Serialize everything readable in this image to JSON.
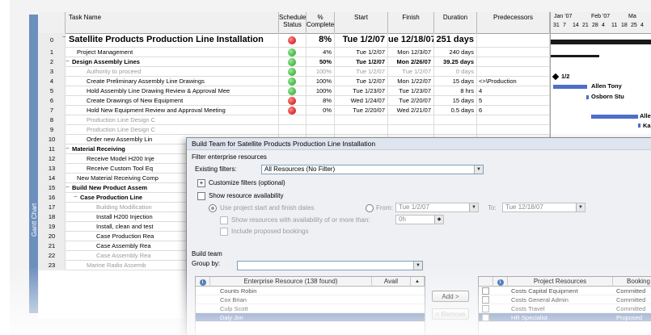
{
  "side_tab": "Gantt Chart",
  "columns": {
    "task_name": "Task Name",
    "schedule_status": "Schedule Status",
    "percent_complete": "% Complete",
    "start": "Start",
    "finish": "Finish",
    "duration": "Duration",
    "predecessors": "Predecessors"
  },
  "gantt_header": {
    "months": [
      "Jan '07",
      "Feb '07",
      "Ma"
    ],
    "days": [
      "31",
      "7",
      "14",
      "21",
      "28",
      "4",
      "11",
      "18",
      "25",
      "4"
    ]
  },
  "gantt_labels": [
    "1/2",
    "Allen Tony",
    "Osborn Stu",
    "Allen",
    "Kahn"
  ],
  "tasks": [
    {
      "id": "0",
      "name": "Satellite Products Production Line Installation",
      "status": "red",
      "pct": "8%",
      "start": "Tue 1/2/07",
      "finish": "ue 12/18/07",
      "duration": "251 days",
      "pred": "",
      "style": "big"
    },
    {
      "id": "1",
      "name": "Project Management",
      "status": "green",
      "pct": "4%",
      "start": "Tue 1/2/07",
      "finish": "Mon 12/3/07",
      "duration": "240 days",
      "pred": "",
      "style": "indent1"
    },
    {
      "id": "2",
      "name": "Design Assembly Lines",
      "status": "green",
      "pct": "50%",
      "start": "Tue 1/2/07",
      "finish": "Mon 2/26/07",
      "duration": "39.25 days",
      "pred": "",
      "style": "summary"
    },
    {
      "id": "3",
      "name": "Authority to proceed",
      "status": "green",
      "pct": "100%",
      "start": "Tue 1/2/07",
      "finish": "Tue 1/2/07",
      "duration": "0 days",
      "pred": "",
      "style": "done"
    },
    {
      "id": "4",
      "name": "Create Preliminary Assembly Line Drawings",
      "status": "green",
      "pct": "100%",
      "start": "Tue 1/2/07",
      "finish": "Mon 1/22/07",
      "duration": "15 days",
      "pred": "<>\\Production",
      "style": "indent2"
    },
    {
      "id": "5",
      "name": "Hold Assembly Line Drawing Review & Approval Mee",
      "status": "green",
      "pct": "100%",
      "start": "Tue 1/23/07",
      "finish": "Tue 1/23/07",
      "duration": "8 hrs",
      "pred": "4",
      "style": "indent2"
    },
    {
      "id": "6",
      "name": "Create Drawings of New Equipment",
      "status": "red",
      "pct": "8%",
      "start": "Wed 1/24/07",
      "finish": "Tue 2/20/07",
      "duration": "15 days",
      "pred": "5",
      "style": "indent2"
    },
    {
      "id": "7",
      "name": "Hold New Equipment Review and Approval Meeting",
      "status": "red",
      "pct": "0%",
      "start": "Tue 2/20/07",
      "finish": "Wed 2/21/07",
      "duration": "0.5 days",
      "pred": "6",
      "style": "indent2"
    },
    {
      "id": "8",
      "name": "Production Line Design C",
      "status": "",
      "pct": "",
      "start": "",
      "finish": "",
      "duration": "",
      "pred": "",
      "style": "done"
    },
    {
      "id": "9",
      "name": "Production Line Design C",
      "status": "",
      "pct": "",
      "start": "",
      "finish": "",
      "duration": "",
      "pred": "",
      "style": "done"
    },
    {
      "id": "10",
      "name": "Order new Assembly Lin",
      "status": "",
      "pct": "",
      "start": "",
      "finish": "",
      "duration": "",
      "pred": "",
      "style": "indent2"
    },
    {
      "id": "11",
      "name": "Material Receiving",
      "status": "",
      "pct": "",
      "start": "",
      "finish": "",
      "duration": "",
      "pred": "",
      "style": "summary"
    },
    {
      "id": "12",
      "name": "Receive Model H200 Inje",
      "status": "",
      "pct": "",
      "start": "",
      "finish": "",
      "duration": "",
      "pred": "",
      "style": "indent2"
    },
    {
      "id": "13",
      "name": "Receive Custom Tool Eq",
      "status": "",
      "pct": "",
      "start": "",
      "finish": "",
      "duration": "",
      "pred": "",
      "style": "indent2"
    },
    {
      "id": "14",
      "name": "New Material Receiving Comp",
      "status": "",
      "pct": "",
      "start": "",
      "finish": "",
      "duration": "",
      "pred": "",
      "style": "indent1"
    },
    {
      "id": "15",
      "name": "Build New Product Assem",
      "status": "",
      "pct": "",
      "start": "",
      "finish": "",
      "duration": "",
      "pred": "",
      "style": "summary"
    },
    {
      "id": "16",
      "name": "Case Production Line",
      "status": "",
      "pct": "",
      "start": "",
      "finish": "",
      "duration": "",
      "pred": "",
      "style": "summary2"
    },
    {
      "id": "17",
      "name": "Building Modification",
      "status": "",
      "pct": "",
      "start": "",
      "finish": "",
      "duration": "",
      "pred": "",
      "style": "done3"
    },
    {
      "id": "18",
      "name": "Install H200 Injection",
      "status": "",
      "pct": "",
      "start": "",
      "finish": "",
      "duration": "",
      "pred": "",
      "style": "indent3"
    },
    {
      "id": "19",
      "name": "Install, clean and test",
      "status": "",
      "pct": "",
      "start": "",
      "finish": "",
      "duration": "",
      "pred": "",
      "style": "indent3"
    },
    {
      "id": "20",
      "name": "Case Production Rea",
      "status": "",
      "pct": "",
      "start": "",
      "finish": "",
      "duration": "",
      "pred": "",
      "style": "indent3"
    },
    {
      "id": "21",
      "name": "Case Assembly Rea",
      "status": "",
      "pct": "",
      "start": "",
      "finish": "",
      "duration": "",
      "pred": "",
      "style": "indent3"
    },
    {
      "id": "22",
      "name": "Case Assembly Rea",
      "status": "",
      "pct": "",
      "start": "",
      "finish": "",
      "duration": "",
      "pred": "",
      "style": "done3"
    },
    {
      "id": "23",
      "name": "Marine Radio Assemb",
      "status": "",
      "pct": "",
      "start": "",
      "finish": "",
      "duration": "",
      "pred": "",
      "style": "done"
    }
  ],
  "dialog": {
    "title": "Build Team for Satellite Products Production Line Installation",
    "filter_section": "Filter enterprise resources",
    "existing_filters_label": "Existing filters:",
    "existing_filters_value": "All Resources (No Filter)",
    "customize_filters": "Customize filters (optional)",
    "show_availability": "Show resource availability",
    "use_project_dates": "Use project start and finish dates",
    "from_label": "From:",
    "from_value": "Tue 1/2/07",
    "to_label": "To:",
    "to_value": "Tue 12/18/07",
    "show_resources_avail": "Show resources with availability of or more than:",
    "avail_value": "0h",
    "include_proposed": "Include proposed bookings",
    "build_team": "Build team",
    "group_by_label": "Group by:",
    "group_by_value": "",
    "enterprise_header": "Enterprise Resource (138 found)",
    "avail_header": "Avail",
    "project_resources_header": "Project Resources",
    "booking_header": "Booking",
    "enterprise_resources": [
      "Counts Robin",
      "Cox Brian",
      "Culp Scott",
      "Daly Jim"
    ],
    "project_resources": [
      {
        "name": "Costs Capital Equipment",
        "booking": "Committed"
      },
      {
        "name": "Costs General Admin",
        "booking": "Committed"
      },
      {
        "name": "Costs Travel",
        "booking": "Committed"
      },
      {
        "name": "HR Specialist",
        "booking": "Proposed"
      }
    ],
    "add_button": "Add >",
    "remove_button": "< Remove"
  }
}
